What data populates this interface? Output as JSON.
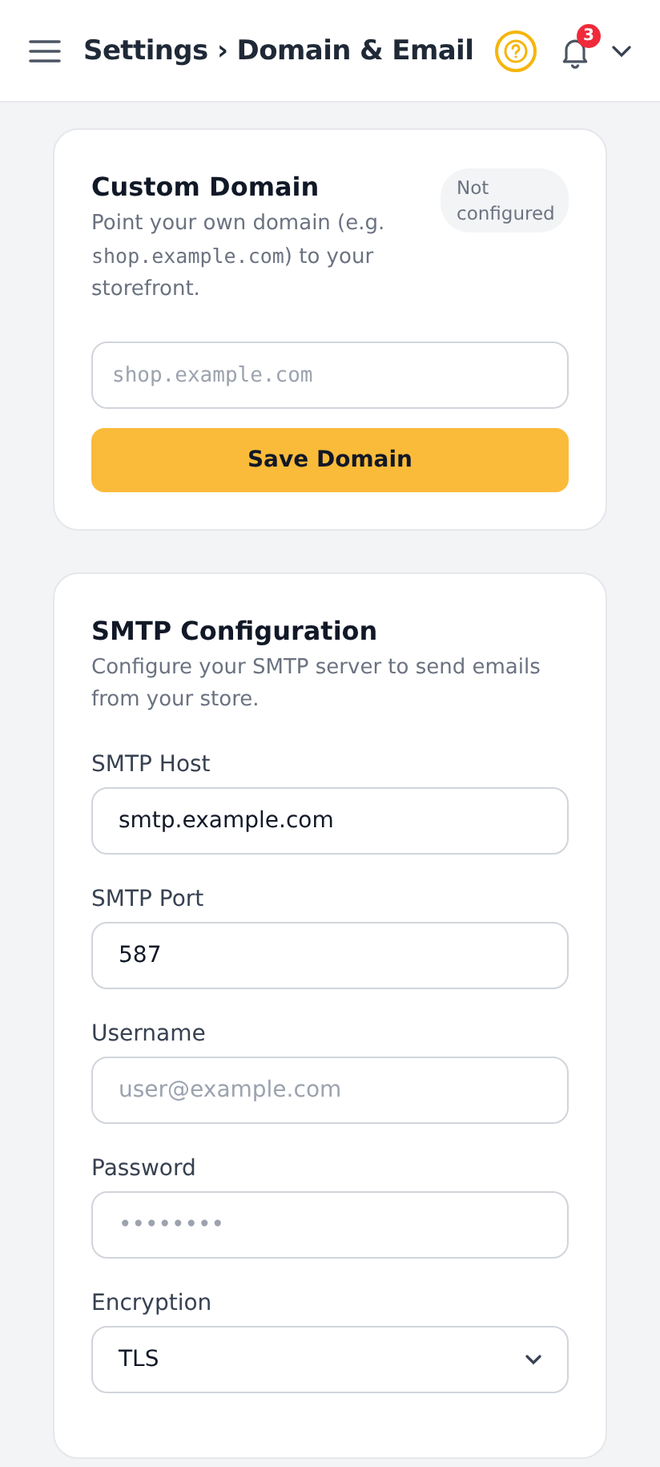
{
  "header": {
    "breadcrumb": "Settings › Domain & Email",
    "notification_count": "3"
  },
  "custom_domain": {
    "title": "Custom Domain",
    "status": "Not configured",
    "description_before": "Point your own domain (e.g. ",
    "description_code": "shop.example.com",
    "description_after": ") to your storefront.",
    "input_placeholder": "shop.example.com",
    "button": "Save Domain"
  },
  "smtp": {
    "title": "SMTP Configuration",
    "description": "Configure your SMTP server to send emails from your store.",
    "fields": [
      {
        "label": "SMTP Host",
        "kind": "text",
        "value": "smtp.example.com"
      },
      {
        "label": "SMTP Port",
        "kind": "text",
        "value": "587"
      },
      {
        "label": "Username",
        "kind": "text",
        "placeholder": "user@example.com"
      },
      {
        "label": "Password",
        "kind": "password",
        "placeholder": "••••••••"
      },
      {
        "label": "Encryption",
        "kind": "select",
        "value": "TLS"
      }
    ]
  }
}
